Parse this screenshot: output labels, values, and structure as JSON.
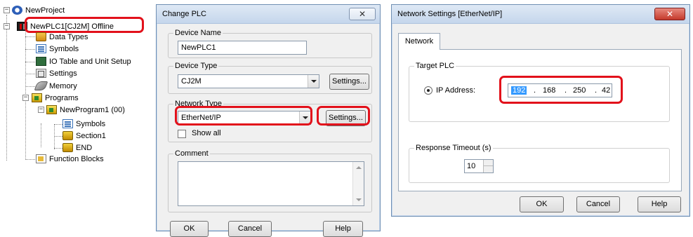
{
  "tree": {
    "root": "NewProject",
    "plc": "NewPLC1[CJ2M] Offline",
    "items": [
      "Data Types",
      "Symbols",
      "IO Table and Unit Setup",
      "Settings",
      "Memory"
    ],
    "programs": "Programs",
    "program1": "NewProgram1 (00)",
    "program_children": [
      "Symbols",
      "Section1",
      "END"
    ],
    "function_blocks": "Function Blocks"
  },
  "change_plc": {
    "title": "Change PLC",
    "device_name_label": "Device Name",
    "device_name_value": "NewPLC1",
    "device_type_label": "Device Type",
    "device_type_value": "CJ2M",
    "settings_label": "Settings...",
    "network_type_label": "Network Type",
    "network_type_value": "EtherNet/IP",
    "network_settings_label": "Settings...",
    "show_all_label": "Show all",
    "comment_label": "Comment",
    "ok_label": "OK",
    "cancel_label": "Cancel",
    "help_label": "Help"
  },
  "network_settings": {
    "title": "Network Settings [EtherNet/IP]",
    "tab_label": "Network",
    "target_plc_label": "Target PLC",
    "ip_label": "IP Address:",
    "ip": [
      "192",
      "168",
      "250",
      "42"
    ],
    "response_timeout_label": "Response Timeout (s)",
    "response_timeout_value": "10",
    "ok_label": "OK",
    "cancel_label": "Cancel",
    "help_label": "Help"
  },
  "colors": {
    "highlight_red": "#e2111b",
    "selection_blue": "#3399ff"
  }
}
